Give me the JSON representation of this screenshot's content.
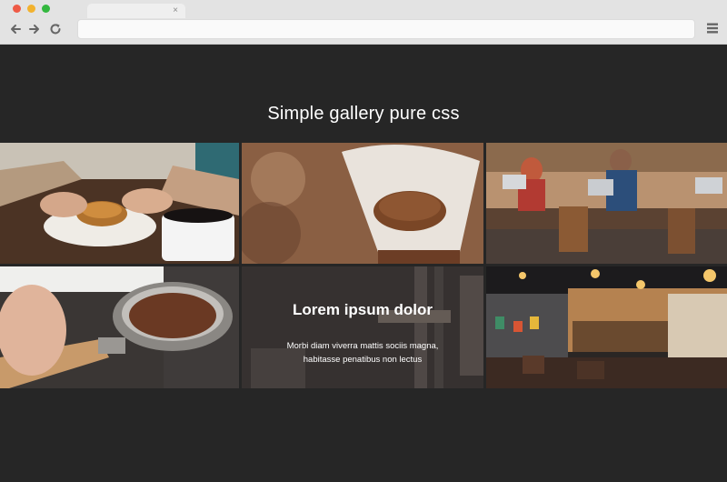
{
  "browser": {
    "tab_close_glyph": "×",
    "icons": [
      "back-arrow-icon",
      "forward-arrow-icon",
      "reload-icon",
      "hamburger-menu-icon"
    ],
    "address_value": ""
  },
  "page": {
    "title": "Simple gallery pure css",
    "background": "#262626"
  },
  "gallery": {
    "items": [
      {
        "name": "croissant-and-coffee-photo"
      },
      {
        "name": "coffee-filter-grounds-photo"
      },
      {
        "name": "cafe-people-laptops-photo"
      },
      {
        "name": "portafilter-coffee-photo"
      },
      {
        "name": "espresso-machine-photo",
        "overlay": {
          "title": "Lorem ipsum dolor",
          "text": "Morbi diam viverra mattis sociis magna, habitasse penatibus non lectus"
        }
      },
      {
        "name": "cafe-interior-photo"
      }
    ]
  }
}
